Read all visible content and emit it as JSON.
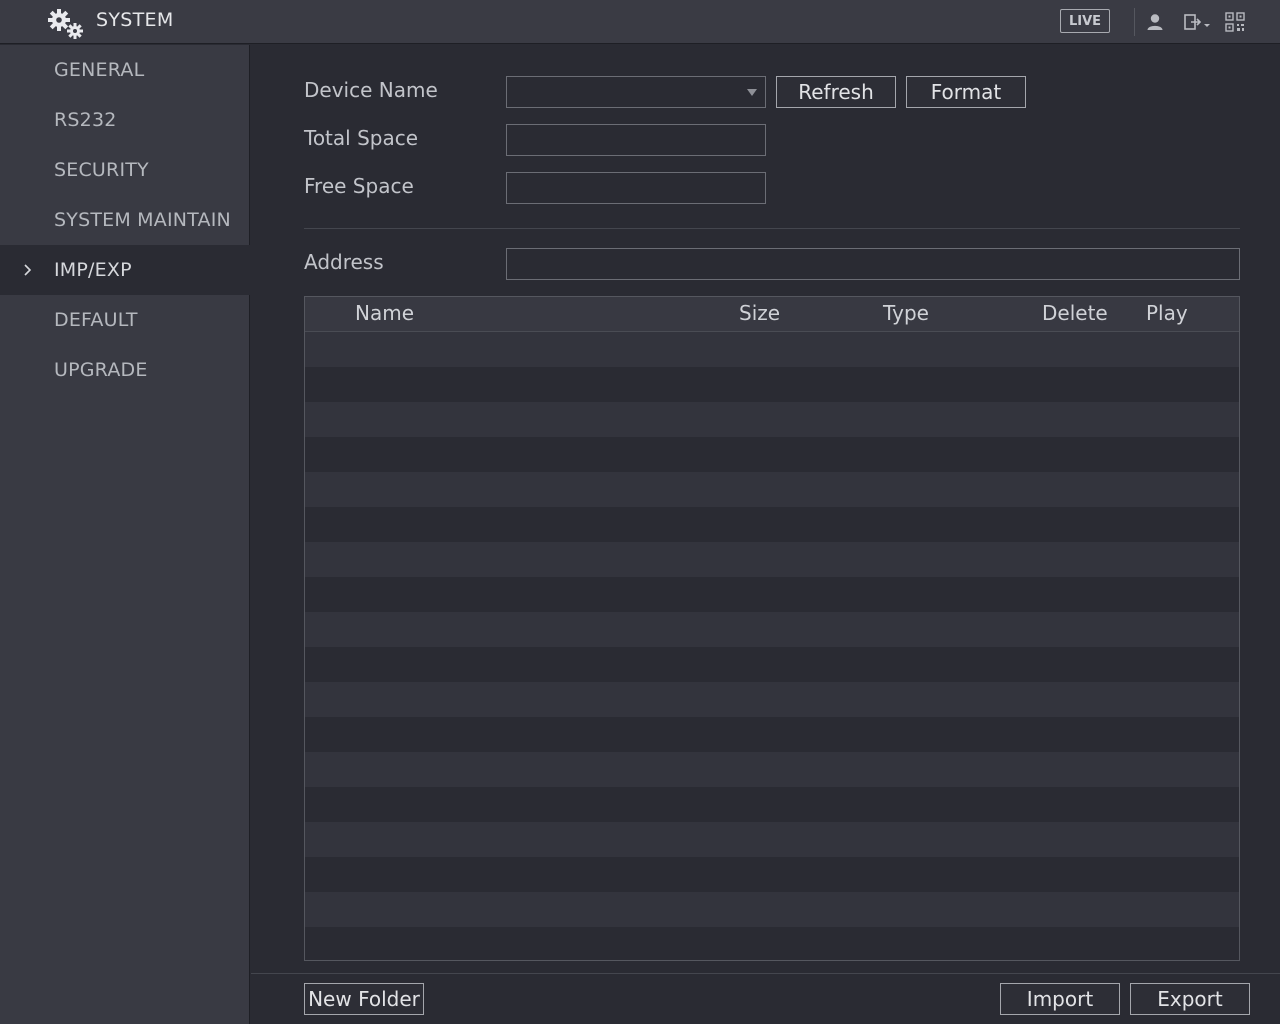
{
  "header": {
    "title": "SYSTEM",
    "live_label": "LIVE",
    "icons": [
      "gears-icon",
      "user-icon",
      "logout-icon",
      "qr-code-icon"
    ]
  },
  "sidebar": {
    "items": [
      {
        "label": "GENERAL",
        "active": false
      },
      {
        "label": "RS232",
        "active": false
      },
      {
        "label": "SECURITY",
        "active": false
      },
      {
        "label": "SYSTEM MAINTAIN",
        "active": false
      },
      {
        "label": "IMP/EXP",
        "active": true
      },
      {
        "label": "DEFAULT",
        "active": false
      },
      {
        "label": "UPGRADE",
        "active": false
      }
    ]
  },
  "form": {
    "device_name_label": "Device Name",
    "device_name_value": "",
    "total_space_label": "Total Space",
    "total_space_value": "",
    "free_space_label": "Free Space",
    "free_space_value": "",
    "address_label": "Address",
    "address_value": "",
    "refresh_label": "Refresh",
    "format_label": "Format"
  },
  "table": {
    "columns": [
      "Name",
      "Size",
      "Type",
      "Delete",
      "Play"
    ],
    "rows": []
  },
  "footer": {
    "new_folder_label": "New Folder",
    "import_label": "Import",
    "export_label": "Export"
  }
}
